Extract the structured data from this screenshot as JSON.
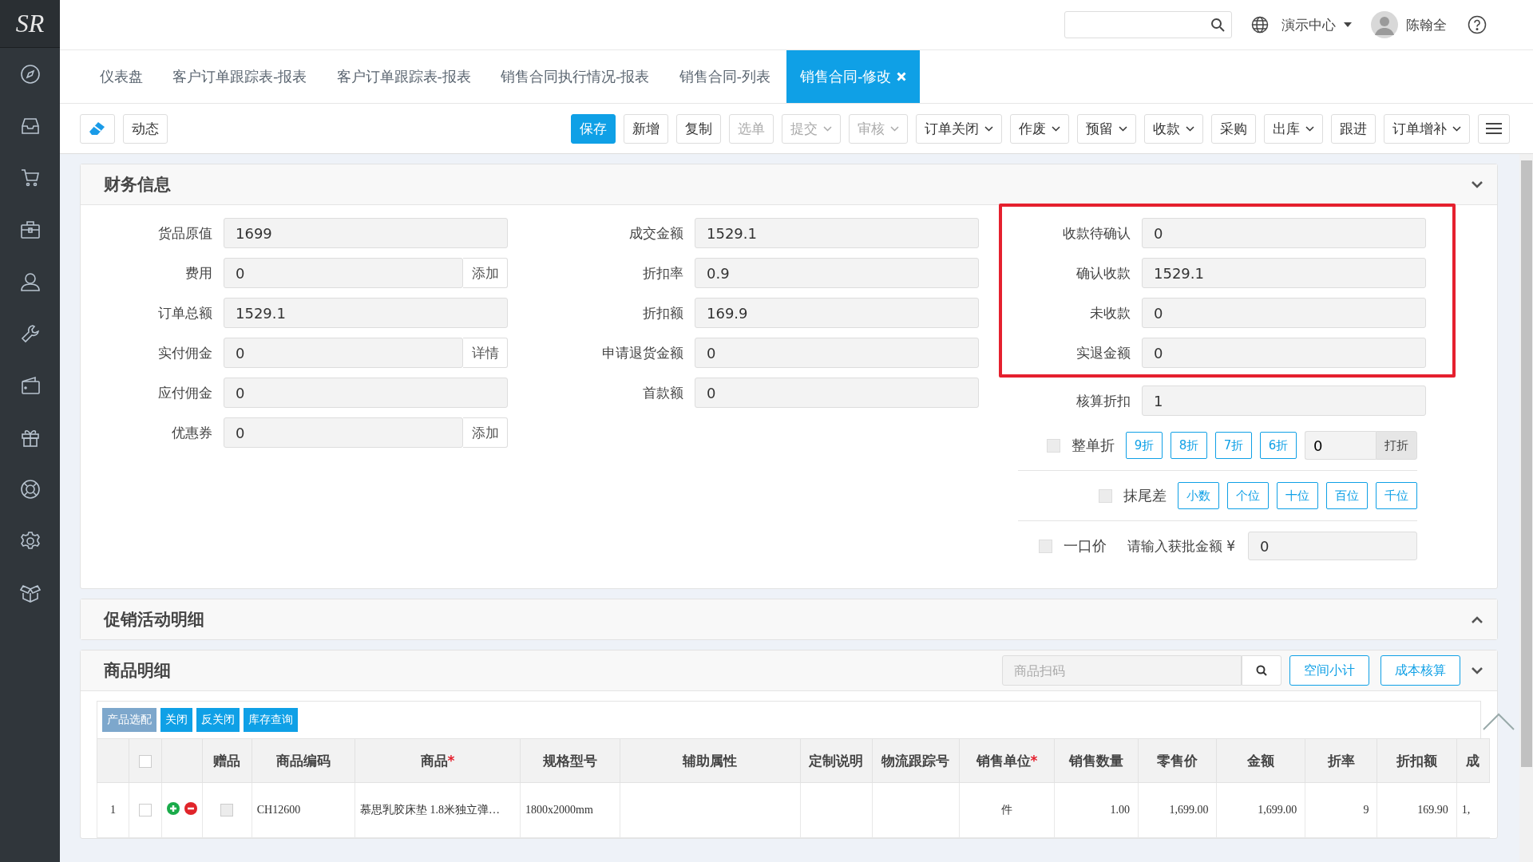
{
  "sidebar": {
    "logo": "SR"
  },
  "header": {
    "org": "演示中心",
    "user": "陈翰全"
  },
  "tabs": [
    {
      "label": "仪表盘",
      "selected": false
    },
    {
      "label": "客户订单跟踪表-报表",
      "selected": false
    },
    {
      "label": "客户订单跟踪表-报表",
      "selected": false
    },
    {
      "label": "销售合同执行情况-报表",
      "selected": false
    },
    {
      "label": "销售合同-列表",
      "selected": false
    },
    {
      "label": "销售合同-修改",
      "selected": true
    }
  ],
  "toolbar": {
    "left": [
      {
        "kind": "icon"
      },
      {
        "kind": "text",
        "label": "动态"
      }
    ],
    "buttons": [
      {
        "label": "保存",
        "kind": "primary",
        "dropdown": false,
        "disabled": false
      },
      {
        "label": "新增",
        "kind": "normal",
        "dropdown": false,
        "disabled": false
      },
      {
        "label": "复制",
        "kind": "normal",
        "dropdown": false,
        "disabled": false
      },
      {
        "label": "选单",
        "kind": "normal",
        "dropdown": false,
        "disabled": true
      },
      {
        "label": "提交",
        "kind": "normal",
        "dropdown": true,
        "disabled": true
      },
      {
        "label": "审核",
        "kind": "normal",
        "dropdown": true,
        "disabled": true
      },
      {
        "label": "订单关闭",
        "kind": "normal",
        "dropdown": true,
        "disabled": false
      },
      {
        "label": "作废",
        "kind": "normal",
        "dropdown": true,
        "disabled": false
      },
      {
        "label": "预留",
        "kind": "normal",
        "dropdown": true,
        "disabled": false
      },
      {
        "label": "收款",
        "kind": "normal",
        "dropdown": true,
        "disabled": false
      },
      {
        "label": "采购",
        "kind": "normal",
        "dropdown": false,
        "disabled": false
      },
      {
        "label": "出库",
        "kind": "normal",
        "dropdown": true,
        "disabled": false
      },
      {
        "label": "跟进",
        "kind": "normal",
        "dropdown": false,
        "disabled": false
      },
      {
        "label": "订单增补",
        "kind": "normal",
        "dropdown": true,
        "disabled": false
      }
    ]
  },
  "finance": {
    "title": "财务信息",
    "expanded": true,
    "column_1": [
      {
        "label": "货品原值",
        "value": "1699"
      },
      {
        "label": "费用",
        "value": "0",
        "action": "添加"
      },
      {
        "label": "订单总额",
        "value": "1529.1"
      },
      {
        "label": "实付佣金",
        "value": "0",
        "action": "详情"
      },
      {
        "label": "应付佣金",
        "value": "0"
      },
      {
        "label": "优惠券",
        "value": "0",
        "action": "添加"
      }
    ],
    "column_2": [
      {
        "label": "成交金额",
        "value": "1529.1"
      },
      {
        "label": "折扣率",
        "value": "0.9"
      },
      {
        "label": "折扣额",
        "value": "169.9"
      },
      {
        "label": "申请退货金额",
        "value": "0"
      },
      {
        "label": "首款额",
        "value": "0"
      }
    ],
    "column_3": {
      "marked": [
        {
          "label": "收款待确认",
          "value": "0"
        },
        {
          "label": "确认收款",
          "value": "1529.1"
        },
        {
          "label": "未收款",
          "value": "0"
        },
        {
          "label": "实退金额",
          "value": "0"
        }
      ],
      "fields": [
        {
          "label": "核算折扣",
          "value": "1"
        }
      ]
    },
    "whole_discount": {
      "label": "整单折",
      "checked": false,
      "options": [
        "9折",
        "8折",
        "7折",
        "6折"
      ],
      "value": "0",
      "apply": "打折"
    },
    "rounding": {
      "label": "抹尾差",
      "checked": false,
      "options": [
        "小数",
        "个位",
        "十位",
        "百位",
        "千位"
      ]
    },
    "fixed_price": {
      "label": "一口价",
      "checked": false,
      "prompt": "请输入获批金额 ¥",
      "value": "0"
    }
  },
  "promotion": {
    "title": "促销活动明细",
    "expanded": false
  },
  "goods": {
    "title": "商品明细",
    "expanded": true,
    "scan": {
      "placeholder": "商品扫码"
    },
    "actions": [
      "空间小计",
      "成本核算"
    ],
    "table_actions": [
      {
        "label": "产品选配",
        "disabled": true
      },
      {
        "label": "关闭",
        "disabled": false
      },
      {
        "label": "反关闭",
        "disabled": false
      },
      {
        "label": "库存查询",
        "disabled": false
      }
    ],
    "table": {
      "select_all": false,
      "gift_column": "赠品",
      "columns": [
        {
          "label": "商品编码"
        },
        {
          "label": "商品",
          "mark": "*"
        },
        {
          "label": "规格型号"
        },
        {
          "label": "辅助属性"
        },
        {
          "label": "定制说明"
        },
        {
          "label": "物流跟踪号"
        },
        {
          "label": "销售单位",
          "mark": "*"
        },
        {
          "label": "销售数量"
        },
        {
          "label": "零售价"
        },
        {
          "label": "金额"
        },
        {
          "label": "折率"
        },
        {
          "label": "折扣额"
        },
        {
          "label": "成"
        }
      ],
      "rows": [
        {
          "index": "1",
          "checked": false,
          "gift": false,
          "cells": [
            "CH12600",
            "慕思乳胶床垫 1.8米独立弹…",
            "1800x2000mm",
            "",
            "",
            "",
            "件",
            "1.00",
            "1,699.00",
            "1,699.00",
            "9",
            "169.90",
            "1,"
          ]
        }
      ]
    }
  }
}
